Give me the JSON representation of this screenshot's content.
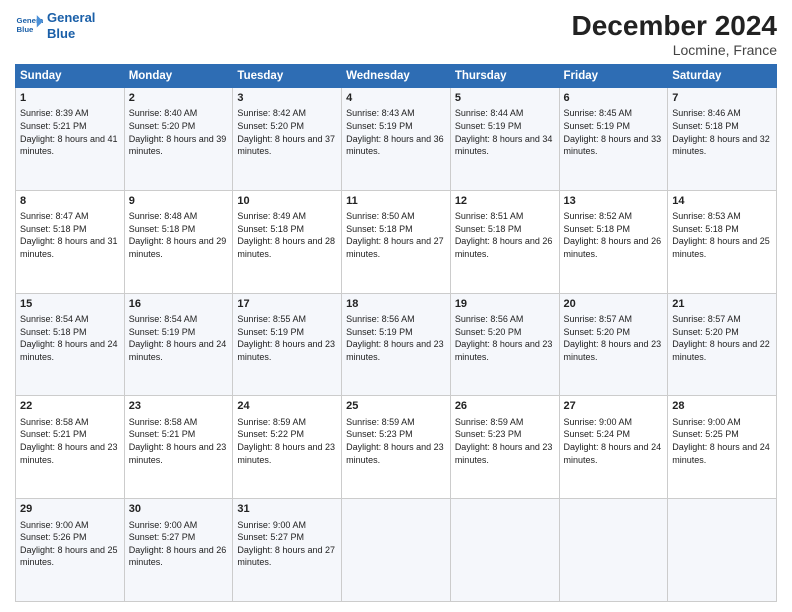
{
  "logo": {
    "line1": "General",
    "line2": "Blue"
  },
  "title": "December 2024",
  "subtitle": "Locmine, France",
  "days_header": [
    "Sunday",
    "Monday",
    "Tuesday",
    "Wednesday",
    "Thursday",
    "Friday",
    "Saturday"
  ],
  "weeks": [
    [
      {
        "day": "1",
        "sunrise": "Sunrise: 8:39 AM",
        "sunset": "Sunset: 5:21 PM",
        "daylight": "Daylight: 8 hours and 41 minutes."
      },
      {
        "day": "2",
        "sunrise": "Sunrise: 8:40 AM",
        "sunset": "Sunset: 5:20 PM",
        "daylight": "Daylight: 8 hours and 39 minutes."
      },
      {
        "day": "3",
        "sunrise": "Sunrise: 8:42 AM",
        "sunset": "Sunset: 5:20 PM",
        "daylight": "Daylight: 8 hours and 37 minutes."
      },
      {
        "day": "4",
        "sunrise": "Sunrise: 8:43 AM",
        "sunset": "Sunset: 5:19 PM",
        "daylight": "Daylight: 8 hours and 36 minutes."
      },
      {
        "day": "5",
        "sunrise": "Sunrise: 8:44 AM",
        "sunset": "Sunset: 5:19 PM",
        "daylight": "Daylight: 8 hours and 34 minutes."
      },
      {
        "day": "6",
        "sunrise": "Sunrise: 8:45 AM",
        "sunset": "Sunset: 5:19 PM",
        "daylight": "Daylight: 8 hours and 33 minutes."
      },
      {
        "day": "7",
        "sunrise": "Sunrise: 8:46 AM",
        "sunset": "Sunset: 5:18 PM",
        "daylight": "Daylight: 8 hours and 32 minutes."
      }
    ],
    [
      {
        "day": "8",
        "sunrise": "Sunrise: 8:47 AM",
        "sunset": "Sunset: 5:18 PM",
        "daylight": "Daylight: 8 hours and 31 minutes."
      },
      {
        "day": "9",
        "sunrise": "Sunrise: 8:48 AM",
        "sunset": "Sunset: 5:18 PM",
        "daylight": "Daylight: 8 hours and 29 minutes."
      },
      {
        "day": "10",
        "sunrise": "Sunrise: 8:49 AM",
        "sunset": "Sunset: 5:18 PM",
        "daylight": "Daylight: 8 hours and 28 minutes."
      },
      {
        "day": "11",
        "sunrise": "Sunrise: 8:50 AM",
        "sunset": "Sunset: 5:18 PM",
        "daylight": "Daylight: 8 hours and 27 minutes."
      },
      {
        "day": "12",
        "sunrise": "Sunrise: 8:51 AM",
        "sunset": "Sunset: 5:18 PM",
        "daylight": "Daylight: 8 hours and 26 minutes."
      },
      {
        "day": "13",
        "sunrise": "Sunrise: 8:52 AM",
        "sunset": "Sunset: 5:18 PM",
        "daylight": "Daylight: 8 hours and 26 minutes."
      },
      {
        "day": "14",
        "sunrise": "Sunrise: 8:53 AM",
        "sunset": "Sunset: 5:18 PM",
        "daylight": "Daylight: 8 hours and 25 minutes."
      }
    ],
    [
      {
        "day": "15",
        "sunrise": "Sunrise: 8:54 AM",
        "sunset": "Sunset: 5:18 PM",
        "daylight": "Daylight: 8 hours and 24 minutes."
      },
      {
        "day": "16",
        "sunrise": "Sunrise: 8:54 AM",
        "sunset": "Sunset: 5:19 PM",
        "daylight": "Daylight: 8 hours and 24 minutes."
      },
      {
        "day": "17",
        "sunrise": "Sunrise: 8:55 AM",
        "sunset": "Sunset: 5:19 PM",
        "daylight": "Daylight: 8 hours and 23 minutes."
      },
      {
        "day": "18",
        "sunrise": "Sunrise: 8:56 AM",
        "sunset": "Sunset: 5:19 PM",
        "daylight": "Daylight: 8 hours and 23 minutes."
      },
      {
        "day": "19",
        "sunrise": "Sunrise: 8:56 AM",
        "sunset": "Sunset: 5:20 PM",
        "daylight": "Daylight: 8 hours and 23 minutes."
      },
      {
        "day": "20",
        "sunrise": "Sunrise: 8:57 AM",
        "sunset": "Sunset: 5:20 PM",
        "daylight": "Daylight: 8 hours and 23 minutes."
      },
      {
        "day": "21",
        "sunrise": "Sunrise: 8:57 AM",
        "sunset": "Sunset: 5:20 PM",
        "daylight": "Daylight: 8 hours and 22 minutes."
      }
    ],
    [
      {
        "day": "22",
        "sunrise": "Sunrise: 8:58 AM",
        "sunset": "Sunset: 5:21 PM",
        "daylight": "Daylight: 8 hours and 23 minutes."
      },
      {
        "day": "23",
        "sunrise": "Sunrise: 8:58 AM",
        "sunset": "Sunset: 5:21 PM",
        "daylight": "Daylight: 8 hours and 23 minutes."
      },
      {
        "day": "24",
        "sunrise": "Sunrise: 8:59 AM",
        "sunset": "Sunset: 5:22 PM",
        "daylight": "Daylight: 8 hours and 23 minutes."
      },
      {
        "day": "25",
        "sunrise": "Sunrise: 8:59 AM",
        "sunset": "Sunset: 5:23 PM",
        "daylight": "Daylight: 8 hours and 23 minutes."
      },
      {
        "day": "26",
        "sunrise": "Sunrise: 8:59 AM",
        "sunset": "Sunset: 5:23 PM",
        "daylight": "Daylight: 8 hours and 23 minutes."
      },
      {
        "day": "27",
        "sunrise": "Sunrise: 9:00 AM",
        "sunset": "Sunset: 5:24 PM",
        "daylight": "Daylight: 8 hours and 24 minutes."
      },
      {
        "day": "28",
        "sunrise": "Sunrise: 9:00 AM",
        "sunset": "Sunset: 5:25 PM",
        "daylight": "Daylight: 8 hours and 24 minutes."
      }
    ],
    [
      {
        "day": "29",
        "sunrise": "Sunrise: 9:00 AM",
        "sunset": "Sunset: 5:26 PM",
        "daylight": "Daylight: 8 hours and 25 minutes."
      },
      {
        "day": "30",
        "sunrise": "Sunrise: 9:00 AM",
        "sunset": "Sunset: 5:27 PM",
        "daylight": "Daylight: 8 hours and 26 minutes."
      },
      {
        "day": "31",
        "sunrise": "Sunrise: 9:00 AM",
        "sunset": "Sunset: 5:27 PM",
        "daylight": "Daylight: 8 hours and 27 minutes."
      },
      null,
      null,
      null,
      null
    ]
  ]
}
